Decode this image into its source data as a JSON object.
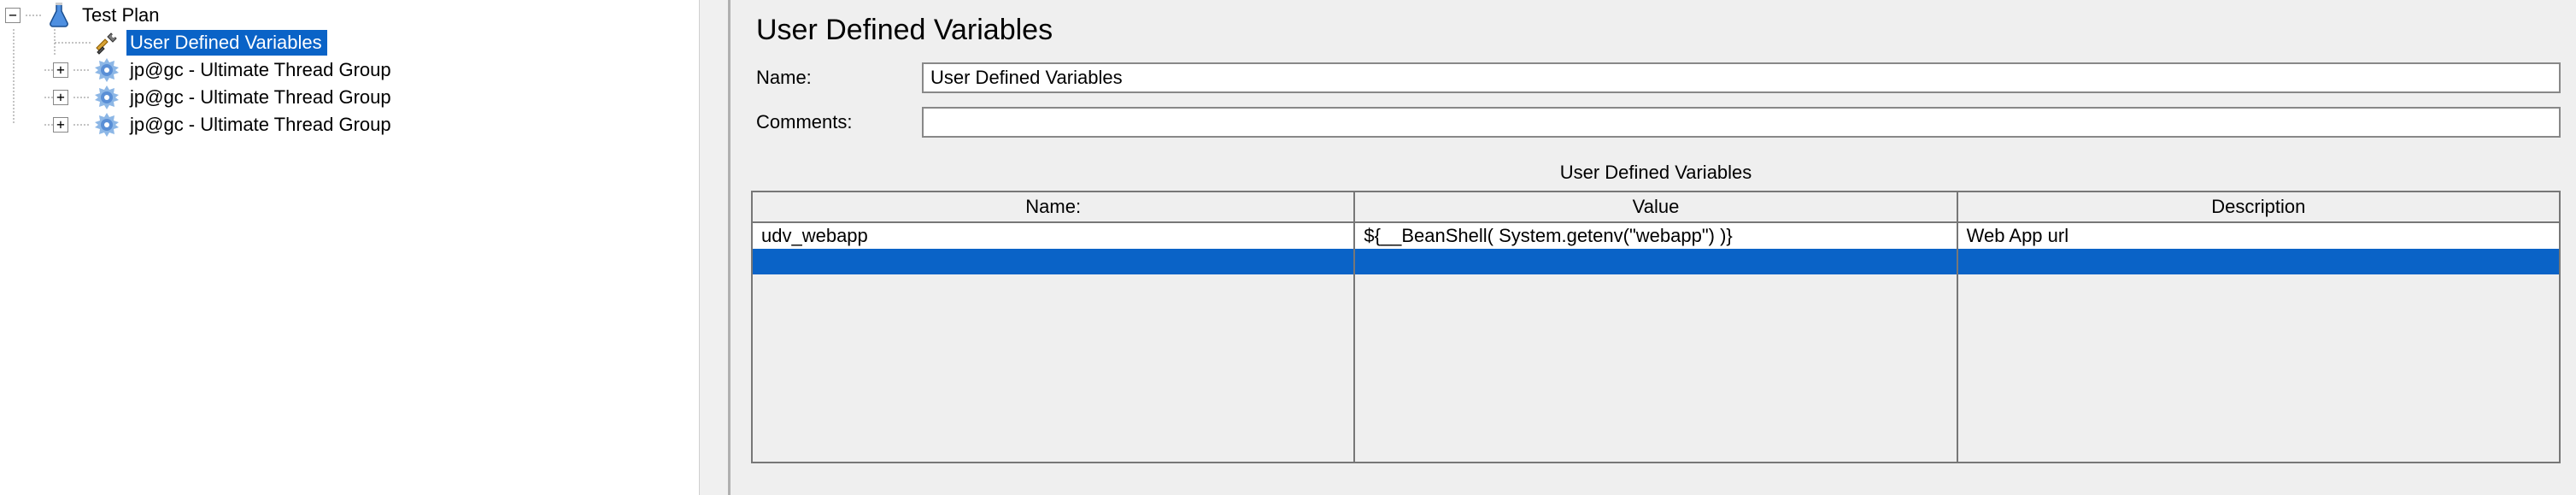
{
  "tree": {
    "root": {
      "label": "Test Plan",
      "icon": "flask-icon"
    },
    "children": [
      {
        "label": "User Defined Variables",
        "icon": "wrench-icon",
        "selected": true
      },
      {
        "label": "jp@gc - Ultimate Thread Group",
        "icon": "gear-icon",
        "expandable": true
      },
      {
        "label": "jp@gc - Ultimate Thread Group",
        "icon": "gear-icon",
        "expandable": true
      },
      {
        "label": "jp@gc - Ultimate Thread Group",
        "icon": "gear-icon",
        "expandable": true
      }
    ]
  },
  "detail": {
    "title": "User Defined Variables",
    "name_label": "Name:",
    "name_value": "User Defined Variables",
    "comments_label": "Comments:",
    "comments_value": "",
    "table_heading": "User Defined Variables",
    "columns": {
      "name": "Name:",
      "value": "Value",
      "description": "Description"
    },
    "rows": [
      {
        "name": "udv_webapp",
        "value": "${__BeanShell( System.getenv(\"webapp\") )}",
        "description": "Web App url"
      }
    ]
  }
}
